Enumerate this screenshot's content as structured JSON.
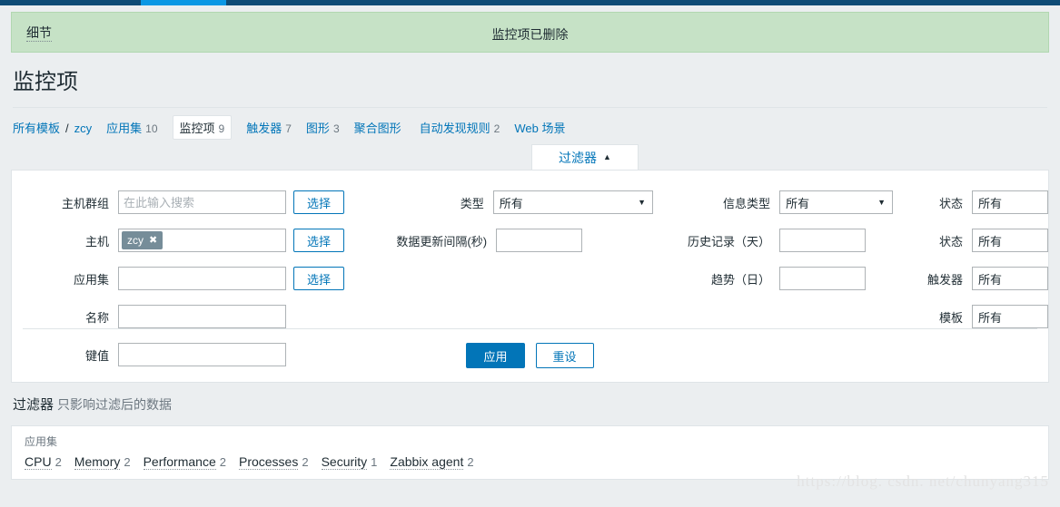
{
  "topbar": {
    "active_item": ""
  },
  "message": {
    "details_label": "细节",
    "text": "监控项已删除"
  },
  "page": {
    "title": "监控项"
  },
  "breadcrumb": {
    "root_label": "所有模板",
    "separator": "/",
    "host_label": "zcy",
    "items": [
      {
        "label": "应用集",
        "count": "10",
        "current": false
      },
      {
        "label": "监控项",
        "count": "9",
        "current": true
      },
      {
        "label": "触发器",
        "count": "7",
        "current": false
      },
      {
        "label": "图形",
        "count": "3",
        "current": false
      },
      {
        "label": "聚合图形",
        "count": "",
        "current": false
      },
      {
        "label": "自动发现规则",
        "count": "2",
        "current": false
      },
      {
        "label": "Web 场景",
        "count": "",
        "current": false
      }
    ]
  },
  "filter_tab": {
    "label": "过滤器",
    "caret": "▲"
  },
  "filter": {
    "col1": [
      {
        "label": "主机群组",
        "type": "input",
        "value": "",
        "placeholder": "在此输入搜索",
        "button": "选择"
      },
      {
        "label": "主机",
        "type": "multiselect",
        "chip": "zcy",
        "chip_close": "✖",
        "button": "选择"
      },
      {
        "label": "应用集",
        "type": "input",
        "value": "",
        "placeholder": "",
        "button": "选择"
      },
      {
        "label": "名称",
        "type": "input",
        "value": "",
        "placeholder": "",
        "button": ""
      },
      {
        "label": "键值",
        "type": "input",
        "value": "",
        "placeholder": "",
        "button": ""
      }
    ],
    "col2": [
      {
        "label": "类型",
        "type": "select",
        "value": "所有",
        "caret": "▼"
      },
      {
        "label": "数据更新间隔(秒)",
        "type": "input",
        "value": "",
        "placeholder": ""
      }
    ],
    "col3": [
      {
        "label": "信息类型",
        "type": "select",
        "value": "所有",
        "caret": "▼"
      },
      {
        "label": "历史记录（天）",
        "type": "input",
        "value": "",
        "placeholder": ""
      },
      {
        "label": "趋势（日）",
        "type": "input",
        "value": "",
        "placeholder": ""
      }
    ],
    "col4": [
      {
        "label": "状态",
        "type": "select",
        "value": "所有"
      },
      {
        "label": "状态",
        "type": "select",
        "value": "所有"
      },
      {
        "label": "触发器",
        "type": "select",
        "value": "所有"
      },
      {
        "label": "模板",
        "type": "select",
        "value": "所有"
      }
    ],
    "apply_label": "应用",
    "reset_label": "重设"
  },
  "filter_note": {
    "title": "过滤器",
    "subtitle": "只影响过滤后的数据"
  },
  "list": {
    "section_label": "应用集",
    "applications": [
      {
        "name": "CPU",
        "count": "2"
      },
      {
        "name": "Memory",
        "count": "2"
      },
      {
        "name": "Performance",
        "count": "2"
      },
      {
        "name": "Processes",
        "count": "2"
      },
      {
        "name": "Security",
        "count": "1"
      },
      {
        "name": "Zabbix agent",
        "count": "2"
      }
    ]
  },
  "watermark": {
    "text": "https://blog. csdn. net/chunyang315"
  },
  "colors": {
    "navbar": "#0e4b75",
    "navbar_active": "#0a97e4",
    "accent": "#0275b8",
    "success_bg": "#c6e2c6",
    "chip_bg": "#768d99",
    "page_bg": "#ebeef0"
  }
}
